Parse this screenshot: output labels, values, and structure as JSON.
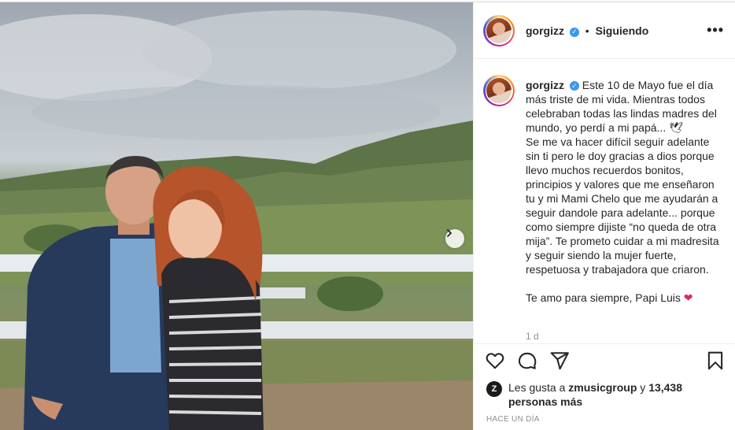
{
  "post": {
    "username": "gorgizz",
    "verified_symbol": "✓",
    "separator": "•",
    "follow_status": "Siguiendo",
    "more_label": "•••",
    "caption_lines": [
      "Este 10 de Mayo fue el día más triste de mi vida. Mientras todos celebraban todas las lindas madres del mundo, yo perdí a mi papá... 🕊",
      "Se me va hacer difícil seguir adelante sin ti pero le doy gracias a dios porque llevo muchos recuerdos bonitos, principios y valores que me enseñaron tu y mi Mami Chelo que me ayudarán a seguir dandole para adelante... porque como siempre dijiste “no queda de otra mija”. Te prometo cuidar a mi madresita y seguir siendo la mujer fuerte, respetuosa y trabajadora que criaron.",
      "Te amo para siempre, Papi Luis"
    ],
    "heart_emoji": "❤",
    "time_short": "1 d",
    "likes_prefix": "Les gusta a",
    "likes_user": "zmusicgroup",
    "likes_and": "y",
    "likes_count": "13,438 personas más",
    "time_ago": "HACE UN DÍA",
    "likes_avatar_letter": "Z"
  },
  "icons": {
    "like": "heart-outline-icon",
    "comment": "comment-bubble-icon",
    "share": "paper-plane-icon",
    "save": "bookmark-icon",
    "next": "chevron-right-icon"
  },
  "colors": {
    "verified": "#3897f0",
    "heart": "#e0245e",
    "text": "#262626",
    "muted": "#8e8e8e"
  }
}
